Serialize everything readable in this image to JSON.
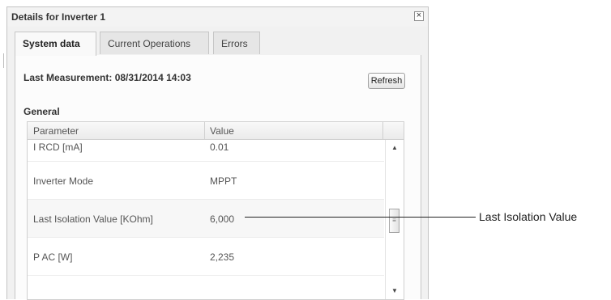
{
  "dialog": {
    "title": "Details for Inverter 1",
    "close_glyph": "×",
    "tabs": [
      {
        "label": "System data",
        "active": true
      },
      {
        "label": "Current Operations",
        "active": false
      },
      {
        "label": "Errors",
        "active": false
      }
    ],
    "last_measurement": "Last Measurement: 08/31/2014 14:03",
    "refresh_label": "Refresh",
    "section_title": "General",
    "grid": {
      "columns": [
        "Parameter",
        "Value"
      ],
      "rows": [
        {
          "parameter": "I RCD [mA]",
          "value": "0.01"
        },
        {
          "parameter": "Inverter Mode",
          "value": "MPPT"
        },
        {
          "parameter": "Last Isolation Value [KOhm]",
          "value": "6,000"
        },
        {
          "parameter": "P AC [W]",
          "value": "2,235"
        }
      ],
      "scroll_up_glyph": "▲",
      "scroll_down_glyph": "▼",
      "thumb_glyph": "≡"
    }
  },
  "callout": {
    "label": "Last Isolation Value"
  }
}
